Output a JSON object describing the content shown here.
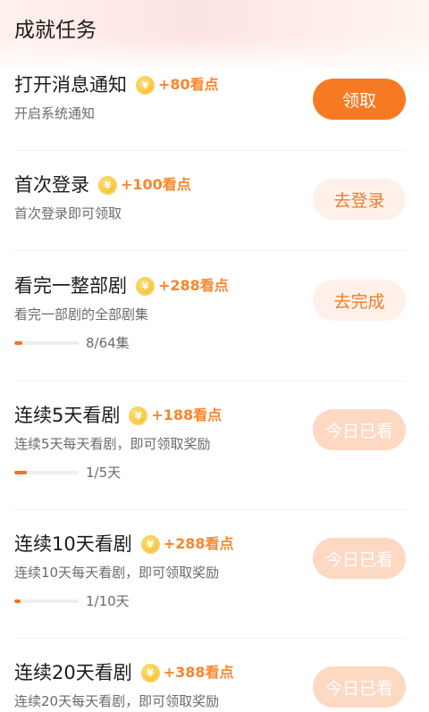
{
  "header": {
    "title": "成就任务"
  },
  "coin_glyph": "¥",
  "colors": {
    "accent": "#f77a22",
    "reward": "#f7862d",
    "soft_button_bg": "#fff1e9",
    "disabled_button_bg": "#fdd8c3"
  },
  "tasks": [
    {
      "name": "打开消息通知",
      "reward": "+80看点",
      "desc": "开启系统通知",
      "button": "领取",
      "button_state": "primary"
    },
    {
      "name": "首次登录",
      "reward": "+100看点",
      "desc": "首次登录即可领取",
      "button": "去登录",
      "button_state": "soft"
    },
    {
      "name": "看完一整部剧",
      "reward": "+288看点",
      "desc": "看完一部剧的全部剧集",
      "progress_text": "8/64集",
      "progress": 0.125,
      "button": "去完成",
      "button_state": "soft"
    },
    {
      "name": "连续5天看剧",
      "reward": "+188看点",
      "desc": "连续5天每天看剧，即可领取奖励",
      "progress_text": "1/5天",
      "progress": 0.2,
      "button": "今日已看",
      "button_state": "disabled"
    },
    {
      "name": "连续10天看剧",
      "reward": "+288看点",
      "desc": "连续10天每天看剧，即可领取奖励",
      "progress_text": "1/10天",
      "progress": 0.1,
      "button": "今日已看",
      "button_state": "disabled"
    },
    {
      "name": "连续20天看剧",
      "reward": "+388看点",
      "desc": "连续20天每天看剧，即可领取奖励",
      "button": "今日已看",
      "button_state": "disabled"
    }
  ]
}
